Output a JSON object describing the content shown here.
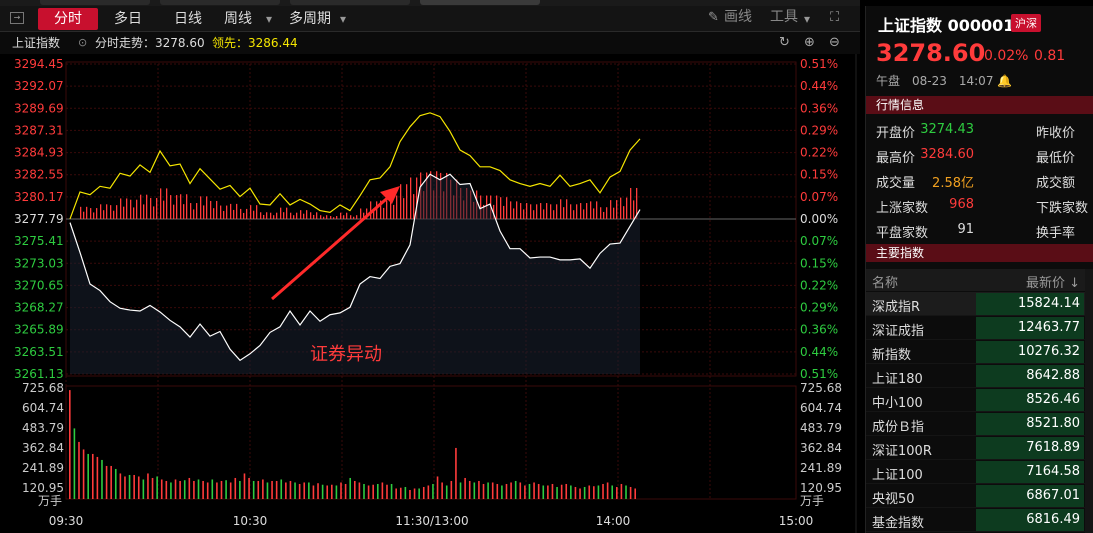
{
  "toolbar": {
    "tabs": [
      "分时",
      "多日",
      "日线",
      "周线",
      "多周期"
    ],
    "draw_label": "画线",
    "tools_label": "工具"
  },
  "chart_header": {
    "index_name": "上证指数",
    "trend_label": "分时走势：3278.60",
    "lead_label": "领先：3286.44"
  },
  "annotation": "证券异动",
  "colors": {
    "up": "#ff3b3b",
    "down": "#2ecc40",
    "price_line": "#ffffff",
    "lead_line": "#f5e600",
    "accent": "#c8102e"
  },
  "chart_data": {
    "type": "line",
    "y_left_ticks": [
      "3294.45",
      "3292.07",
      "3289.69",
      "3287.31",
      "3284.93",
      "3282.55",
      "3280.17",
      "3277.79",
      "3275.41",
      "3273.03",
      "3270.65",
      "3268.27",
      "3265.89",
      "3263.51",
      "3261.13"
    ],
    "y_right_ticks": [
      "0.51%",
      "0.44%",
      "0.36%",
      "0.29%",
      "0.22%",
      "0.15%",
      "0.07%",
      "0.00%",
      "0.07%",
      "0.15%",
      "0.22%",
      "0.29%",
      "0.36%",
      "0.44%",
      "0.51%"
    ],
    "prev_close": 3277.79,
    "ylim": [
      3261.13,
      3294.45
    ],
    "x_ticks": [
      "09:30",
      "10:30",
      "11:30/13:00",
      "14:00",
      "15:00"
    ],
    "volume_ticks": [
      "725.68",
      "604.74",
      "483.79",
      "362.84",
      "241.89",
      "120.95"
    ],
    "volume_unit": "万手",
    "price": [
      3277.4,
      3274.2,
      3270.8,
      3270.1,
      3268.9,
      3268.2,
      3268.0,
      3267.9,
      3268.5,
      3267.8,
      3266.9,
      3266.2,
      3265.1,
      3266.5,
      3265.2,
      3265.7,
      3263.8,
      3262.6,
      3263.3,
      3264.2,
      3265.6,
      3266.2,
      3267.9,
      3266.4,
      3267.9,
      3266.8,
      3267.5,
      3267.7,
      3268.3,
      3270.8,
      3271.6,
      3271.4,
      3272.7,
      3273.0,
      3275.0,
      3281.2,
      3282.6,
      3282.0,
      3282.6,
      3281.5,
      3281.6,
      3278.9,
      3279.4,
      3276.5,
      3274.6,
      3274.6,
      3273.6,
      3273.7,
      3273.7,
      3273.4,
      3273.4,
      3273.5,
      3272.5,
      3274.1,
      3275.1,
      3275.2,
      3277.0,
      3278.8
    ],
    "lead": [
      3277.8,
      3280.7,
      3280.4,
      3281.3,
      3281.1,
      3282.7,
      3282.4,
      3283.6,
      3282.8,
      3285.1,
      3283.5,
      3283.7,
      3281.6,
      3283.2,
      3282.1,
      3281.0,
      3281.4,
      3280.2,
      3281.1,
      3279.4,
      3279.3,
      3280.5,
      3279.3,
      3279.9,
      3279.4,
      3278.7,
      3278.5,
      3279.3,
      3278.7,
      3280.3,
      3282.0,
      3282.2,
      3283.4,
      3286.1,
      3287.7,
      3288.9,
      3289.2,
      3288.8,
      3287.2,
      3285.2,
      3284.6,
      3283.4,
      3283.4,
      3283.0,
      3282.0,
      3281.6,
      3281.3,
      3281.6,
      3281.3,
      3282.5,
      3281.3,
      3281.6,
      3282.0,
      3280.6,
      3282.3,
      3282.9,
      3285.2,
      3286.4
    ],
    "volume": [
      725,
      470,
      380,
      330,
      300,
      300,
      280,
      260,
      220,
      220,
      200,
      170,
      150,
      160,
      160,
      150,
      130,
      170,
      140,
      150,
      130,
      120,
      110,
      130,
      120,
      125,
      140,
      120,
      130,
      120,
      110,
      130,
      110,
      120,
      125,
      110,
      140,
      120,
      170,
      140,
      120,
      120,
      130,
      110,
      120,
      120,
      130,
      110,
      120,
      110,
      100,
      110,
      110,
      90,
      105,
      95,
      90,
      95,
      90,
      110,
      100,
      140,
      120,
      110,
      100,
      90,
      95,
      100,
      110,
      95,
      100,
      70,
      75,
      80,
      60,
      70,
      70,
      80,
      90,
      100,
      150,
      110,
      90,
      120,
      340,
      110,
      140,
      120,
      110,
      120,
      100,
      110,
      110,
      100,
      90,
      100,
      110,
      120,
      110,
      90,
      100,
      110,
      100,
      90,
      90,
      100,
      80,
      95,
      100,
      90,
      80,
      70,
      80,
      90,
      85,
      90,
      100,
      110,
      90,
      80,
      100,
      90,
      80,
      70
    ]
  },
  "right_panel": {
    "title": "上证指数 000001",
    "badge": "沪深",
    "price": "3278.60",
    "change_pct": "0.02%",
    "change": "0.81",
    "session": "午盘　08-23　14:07",
    "quote_section": "行情信息",
    "quotes": [
      {
        "label": "开盘价",
        "value": "3274.43",
        "color": "#2ecc40",
        "label2": "昨收价"
      },
      {
        "label": "最高价",
        "value": "3284.60",
        "color": "#ff3b3b",
        "label2": "最低价"
      },
      {
        "label": "成交量",
        "value": "2.58亿",
        "color": "#f0a020",
        "label2": "成交额"
      },
      {
        "label": "上涨家数",
        "value": "968",
        "color": "#ff3b3b",
        "label2": "下跌家数"
      },
      {
        "label": "平盘家数",
        "value": "91",
        "color": "#ddd",
        "label2": "换手率"
      }
    ],
    "index_section": "主要指数",
    "index_head_name": "名称",
    "index_head_price": "最新价 ↓",
    "indices": [
      {
        "name": "深成指R",
        "price": "15824.14"
      },
      {
        "name": "深证成指",
        "price": "12463.77"
      },
      {
        "name": "新指数",
        "price": "10276.32"
      },
      {
        "name": "上证180",
        "price": "8642.88"
      },
      {
        "name": "中小100",
        "price": "8526.46"
      },
      {
        "name": "成份Ｂ指",
        "price": "8521.80"
      },
      {
        "name": "深证100R",
        "price": "7618.89"
      },
      {
        "name": "上证100",
        "price": "7164.58"
      },
      {
        "name": "央视50",
        "price": "6867.01"
      },
      {
        "name": "基金指数",
        "price": "6816.49"
      }
    ]
  }
}
